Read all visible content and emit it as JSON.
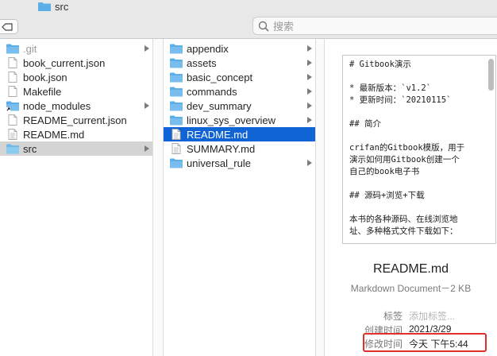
{
  "window": {
    "title": "src"
  },
  "search": {
    "placeholder": "搜索"
  },
  "column1": {
    "items": [
      {
        "label": ".git",
        "type": "folder",
        "dimmed": true,
        "has_children": true
      },
      {
        "label": "book_current.json",
        "type": "file",
        "has_children": false
      },
      {
        "label": "book.json",
        "type": "file",
        "has_children": false
      },
      {
        "label": "Makefile",
        "type": "file",
        "has_children": false
      },
      {
        "label": "node_modules",
        "type": "alias-folder",
        "has_children": true
      },
      {
        "label": "README_current.json",
        "type": "file",
        "has_children": false
      },
      {
        "label": "README.md",
        "type": "md-file",
        "has_children": false
      },
      {
        "label": "src",
        "type": "folder",
        "selected": true,
        "has_children": true
      }
    ]
  },
  "column2": {
    "items": [
      {
        "label": "appendix",
        "type": "folder",
        "has_children": true
      },
      {
        "label": "assets",
        "type": "folder",
        "has_children": true
      },
      {
        "label": "basic_concept",
        "type": "folder",
        "has_children": true
      },
      {
        "label": "commands",
        "type": "folder",
        "has_children": true
      },
      {
        "label": "dev_summary",
        "type": "folder",
        "has_children": true
      },
      {
        "label": "linux_sys_overview",
        "type": "folder",
        "has_children": true
      },
      {
        "label": "README.md",
        "type": "md-file",
        "selected": true,
        "has_children": false
      },
      {
        "label": "SUMMARY.md",
        "type": "md-file",
        "has_children": false
      },
      {
        "label": "universal_rule",
        "type": "folder",
        "has_children": true
      }
    ]
  },
  "preview": {
    "doc_lines": [
      "# Gitbook演示",
      "* 最新版本：`v1.2`",
      "* 更新时间：`20210115`",
      "## 简介",
      "crifan的Gitbook模版，用于",
      "演示如何用Gitbook创建一个",
      "自己的book电子书",
      "## 源码+浏览+下载",
      "本书的各种源码、在线浏览地",
      "址、多种格式文件下载如下："
    ],
    "file_name": "README.md",
    "file_kind": "Markdown Document－2 KB",
    "meta": {
      "tags_key": "标签",
      "tags_placeholder": "添加标签...",
      "created_key": "创建时间",
      "created_value": "2021/3/29",
      "modified_key": "修改时间",
      "modified_value": "今天 下午5:44"
    }
  },
  "colors": {
    "selection_blue": "#1064d6",
    "selection_grey": "#d4d4d4",
    "folder_blue": "#5aafe8",
    "highlight_red": "#e0302b"
  }
}
